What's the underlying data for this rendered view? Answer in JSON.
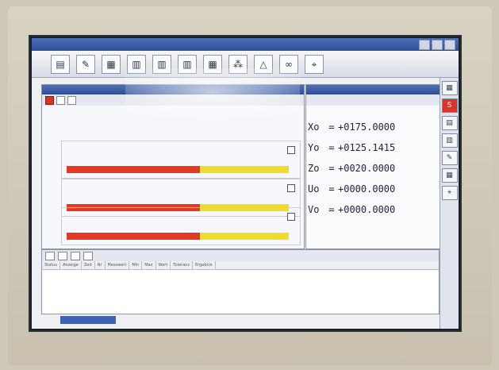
{
  "window": {
    "title": ""
  },
  "toolbar": {
    "icons": [
      "folder-icon",
      "pencil-icon",
      "chart-icon",
      "grid-icon",
      "grid-icon",
      "grid-icon",
      "grid-icon",
      "nodes-icon",
      "triangle-icon",
      "glasses-icon",
      "probe-icon"
    ]
  },
  "coordinates": {
    "header": "",
    "rows": [
      {
        "label": "Xo",
        "value": "+0175.0000"
      },
      {
        "label": "Yo",
        "value": "+0125.1415"
      },
      {
        "label": "Zo",
        "value": "+0020.0000"
      },
      {
        "label": "Uo",
        "value": "+0000.0000"
      },
      {
        "label": "Vo",
        "value": "+0000.0000"
      }
    ]
  },
  "bars": [
    {
      "red_fraction": 0.6,
      "yellow_fraction": 0.4
    },
    {
      "red_fraction": 0.6,
      "yellow_fraction": 0.4
    },
    {
      "red_fraction": 0.6,
      "yellow_fraction": 0.4
    }
  ],
  "list": {
    "columns": [
      "Status",
      "Anzeige",
      "Zeit",
      "Nr",
      "Messwert",
      "Min",
      "Max",
      "Wert",
      "Toleranz",
      "Ergebnis"
    ]
  },
  "colors": {
    "accent": "#2f4f94",
    "bar_red": "#e33a22",
    "bar_yellow": "#f0dc2a"
  }
}
